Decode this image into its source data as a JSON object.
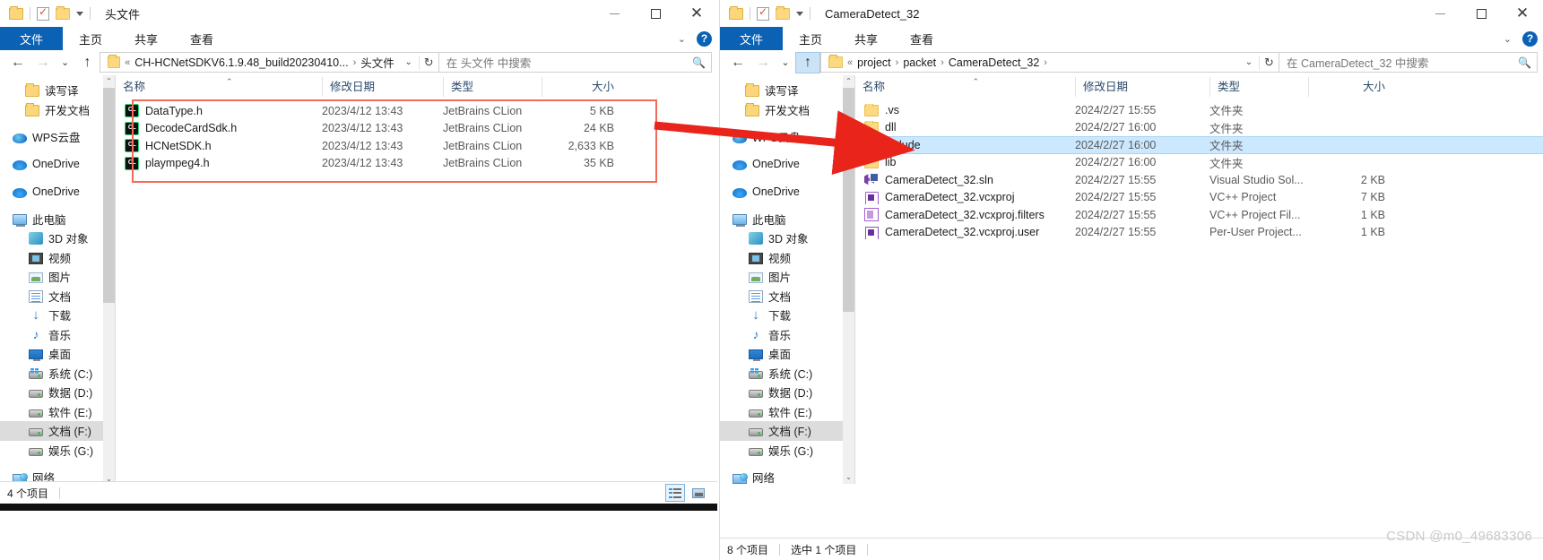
{
  "left_window": {
    "title": "头文件",
    "quick_access": {
      "folder_icon": "folder-icon",
      "properties_icon": "properties-checkbox-icon",
      "new_folder_icon": "new-folder-icon",
      "customize_icon": "chevron-down-icon"
    },
    "caption": {
      "minimize": "—",
      "maximize": "▢",
      "close": "✕"
    },
    "ribbon_tabs": [
      {
        "label": "文件",
        "active": true
      },
      {
        "label": "主页",
        "active": false
      },
      {
        "label": "共享",
        "active": false
      },
      {
        "label": "查看",
        "active": false
      }
    ],
    "ribbon_right": {
      "collapse_icon": "chevron-up-icon",
      "help_icon": "help-icon",
      "help_label": "?"
    },
    "nav": {
      "back_icon": "back-arrow-icon",
      "forward_icon": "forward-arrow-icon",
      "recent_icon": "recent-locations-chevron-icon",
      "up_icon": "up-arrow-icon"
    },
    "address": {
      "crumbs": [
        "«",
        "CH-HCNetSDKV6.1.9.48_build20230410...",
        "›",
        "头文件"
      ],
      "dropdown_icon": "address-dropdown-icon",
      "refresh_icon": "refresh-icon"
    },
    "search": {
      "placeholder": "在 头文件 中搜索",
      "icon": "search-icon"
    },
    "sidebar": [
      {
        "label": "读写译",
        "icon": "folder",
        "indent": 1,
        "selected": false
      },
      {
        "label": "开发文档",
        "icon": "folder",
        "indent": 1,
        "selected": false
      },
      {
        "label": "WPS云盘",
        "icon": "cloud-wps",
        "indent": 0,
        "selected": false,
        "gap_before": true
      },
      {
        "label": "OneDrive",
        "icon": "cloud",
        "indent": 0,
        "selected": false,
        "gap_before": true
      },
      {
        "label": "OneDrive",
        "icon": "cloud",
        "indent": 0,
        "selected": false,
        "gap_before": true
      },
      {
        "label": "此电脑",
        "icon": "pc",
        "indent": 0,
        "selected": false,
        "gap_before": true
      },
      {
        "label": "3D 对象",
        "icon": "obj3d",
        "indent": 2,
        "selected": false
      },
      {
        "label": "视频",
        "icon": "video",
        "indent": 2,
        "selected": false
      },
      {
        "label": "图片",
        "icon": "pic",
        "indent": 2,
        "selected": false
      },
      {
        "label": "文档",
        "icon": "doc",
        "indent": 2,
        "selected": false
      },
      {
        "label": "下载",
        "icon": "dl",
        "indent": 2,
        "selected": false
      },
      {
        "label": "音乐",
        "icon": "music",
        "indent": 2,
        "selected": false
      },
      {
        "label": "桌面",
        "icon": "desk",
        "indent": 2,
        "selected": false
      },
      {
        "label": "系统 (C:)",
        "icon": "drive-sys",
        "indent": 2,
        "selected": false
      },
      {
        "label": "数据 (D:)",
        "icon": "drive",
        "indent": 2,
        "selected": false
      },
      {
        "label": "软件 (E:)",
        "icon": "drive",
        "indent": 2,
        "selected": false
      },
      {
        "label": "文档 (F:)",
        "icon": "drive",
        "indent": 2,
        "selected": true
      },
      {
        "label": "娱乐 (G:)",
        "icon": "drive",
        "indent": 2,
        "selected": false
      },
      {
        "label": "网络",
        "icon": "net",
        "indent": 0,
        "selected": false,
        "gap_before": true
      }
    ],
    "columns": [
      {
        "label": "名称",
        "key": "name"
      },
      {
        "label": "修改日期",
        "key": "date"
      },
      {
        "label": "类型",
        "key": "type"
      },
      {
        "label": "大小",
        "key": "size"
      }
    ],
    "sort_indicator": "ascending-caret",
    "rows": [
      {
        "name": "DataType.h",
        "date": "2023/4/12 13:43",
        "type": "JetBrains CLion",
        "size": "5 KB",
        "icon": "clion",
        "selected": false
      },
      {
        "name": "DecodeCardSdk.h",
        "date": "2023/4/12 13:43",
        "type": "JetBrains CLion",
        "size": "24 KB",
        "icon": "clion",
        "selected": false
      },
      {
        "name": "HCNetSDK.h",
        "date": "2023/4/12 13:43",
        "type": "JetBrains CLion",
        "size": "2,633 KB",
        "icon": "clion",
        "selected": false
      },
      {
        "name": "plaympeg4.h",
        "date": "2023/4/12 13:43",
        "type": "JetBrains CLion",
        "size": "35 KB",
        "icon": "clion",
        "selected": false
      }
    ],
    "status": {
      "count": "4 个项目",
      "selected": ""
    },
    "view_buttons": [
      {
        "name": "details-view",
        "active": true
      },
      {
        "name": "thumbnails-view",
        "active": false
      }
    ]
  },
  "right_window": {
    "title": "CameraDetect_32",
    "caption": {
      "minimize": "—",
      "maximize": "▢",
      "close": "✕"
    },
    "ribbon_tabs": [
      {
        "label": "文件",
        "active": true
      },
      {
        "label": "主页",
        "active": false
      },
      {
        "label": "共享",
        "active": false
      },
      {
        "label": "查看",
        "active": false
      }
    ],
    "ribbon_right": {
      "collapse_icon": "chevron-up-icon",
      "help_icon": "help-icon",
      "help_label": "?"
    },
    "address": {
      "crumbs": [
        "«",
        "project",
        "›",
        "packet",
        "›",
        "CameraDetect_32",
        "›"
      ],
      "dropdown_icon": "address-dropdown-icon",
      "refresh_icon": "refresh-icon"
    },
    "search": {
      "placeholder": "在 CameraDetect_32 中搜索",
      "icon": "search-icon"
    },
    "sidebar": [
      {
        "label": "读写译",
        "icon": "folder",
        "indent": 1,
        "selected": false
      },
      {
        "label": "开发文档",
        "icon": "folder",
        "indent": 1,
        "selected": false
      },
      {
        "label": "WPS云盘",
        "icon": "cloud-wps",
        "indent": 0,
        "selected": false,
        "gap_before": true
      },
      {
        "label": "OneDrive",
        "icon": "cloud",
        "indent": 0,
        "selected": false,
        "gap_before": true
      },
      {
        "label": "OneDrive",
        "icon": "cloud",
        "indent": 0,
        "selected": false,
        "gap_before": true
      },
      {
        "label": "此电脑",
        "icon": "pc",
        "indent": 0,
        "selected": false,
        "gap_before": true
      },
      {
        "label": "3D 对象",
        "icon": "obj3d",
        "indent": 2,
        "selected": false
      },
      {
        "label": "视频",
        "icon": "video",
        "indent": 2,
        "selected": false
      },
      {
        "label": "图片",
        "icon": "pic",
        "indent": 2,
        "selected": false
      },
      {
        "label": "文档",
        "icon": "doc",
        "indent": 2,
        "selected": false
      },
      {
        "label": "下载",
        "icon": "dl",
        "indent": 2,
        "selected": false
      },
      {
        "label": "音乐",
        "icon": "music",
        "indent": 2,
        "selected": false
      },
      {
        "label": "桌面",
        "icon": "desk",
        "indent": 2,
        "selected": false
      },
      {
        "label": "系统 (C:)",
        "icon": "drive-sys",
        "indent": 2,
        "selected": false
      },
      {
        "label": "数据 (D:)",
        "icon": "drive",
        "indent": 2,
        "selected": false
      },
      {
        "label": "软件 (E:)",
        "icon": "drive",
        "indent": 2,
        "selected": false
      },
      {
        "label": "文档 (F:)",
        "icon": "drive",
        "indent": 2,
        "selected": true
      },
      {
        "label": "娱乐 (G:)",
        "icon": "drive",
        "indent": 2,
        "selected": false
      },
      {
        "label": "网络",
        "icon": "net",
        "indent": 0,
        "selected": false,
        "gap_before": true
      }
    ],
    "columns": [
      {
        "label": "名称",
        "key": "name"
      },
      {
        "label": "修改日期",
        "key": "date"
      },
      {
        "label": "类型",
        "key": "type"
      },
      {
        "label": "大小",
        "key": "size"
      }
    ],
    "sort_indicator": "ascending-caret",
    "rows": [
      {
        "name": ".vs",
        "date": "2024/2/27 15:55",
        "type": "文件夹",
        "size": "",
        "icon": "folder",
        "selected": false
      },
      {
        "name": "dll",
        "date": "2024/2/27 16:00",
        "type": "文件夹",
        "size": "",
        "icon": "folder",
        "selected": false
      },
      {
        "name": "include",
        "date": "2024/2/27 16:00",
        "type": "文件夹",
        "size": "",
        "icon": "folder",
        "selected": true
      },
      {
        "name": "lib",
        "date": "2024/2/27 16:00",
        "type": "文件夹",
        "size": "",
        "icon": "folder",
        "selected": false
      },
      {
        "name": "CameraDetect_32.sln",
        "date": "2024/2/27 15:55",
        "type": "Visual Studio Sol...",
        "size": "2 KB",
        "icon": "sln",
        "selected": false
      },
      {
        "name": "CameraDetect_32.vcxproj",
        "date": "2024/2/27 15:55",
        "type": "VC++ Project",
        "size": "7 KB",
        "icon": "vcx",
        "selected": false
      },
      {
        "name": "CameraDetect_32.vcxproj.filters",
        "date": "2024/2/27 15:55",
        "type": "VC++ Project Fil...",
        "size": "1 KB",
        "icon": "filters",
        "selected": false
      },
      {
        "name": "CameraDetect_32.vcxproj.user",
        "date": "2024/2/27 15:55",
        "type": "Per-User Project...",
        "size": "1 KB",
        "icon": "user",
        "selected": false
      }
    ],
    "status": {
      "count": "8 个项目",
      "selected": "选中 1 个项目"
    },
    "view_buttons": [
      {
        "name": "details-view",
        "active": true
      },
      {
        "name": "thumbnails-view",
        "active": false
      }
    ]
  },
  "annotations": {
    "highlight_rect_color": "#f26a5a",
    "arrow_color": "#e8241b"
  },
  "watermark": "CSDN @m0_49683306"
}
